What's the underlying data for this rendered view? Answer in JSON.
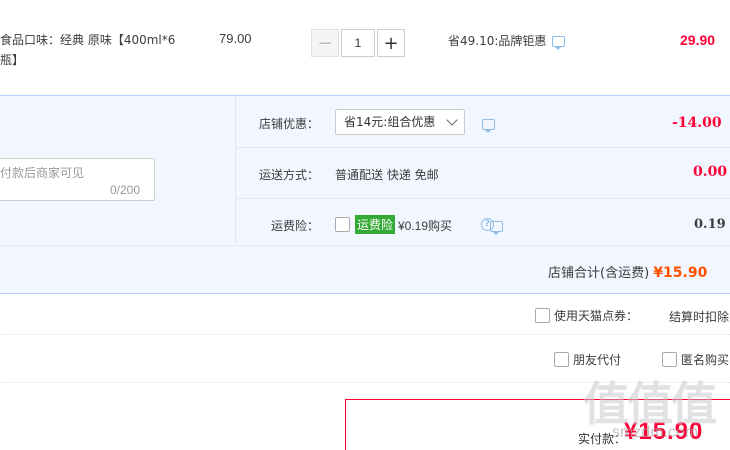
{
  "product": {
    "title_line1": "食品口味：经典 原味【400ml*6",
    "title_line2": "瓶】",
    "unit_price": "79.00",
    "quantity": "1",
    "minus_label": "−",
    "plus_label": "+",
    "promo_text": "省49.10:品牌钜惠",
    "item_total": "29.90"
  },
  "memo": {
    "placeholder": "付款后商家可见",
    "counter": "0/200"
  },
  "store": {
    "discount_label": "店铺优惠：",
    "discount_selected": "省14元:组合优惠",
    "discount_value": "-14.00",
    "shipping_label": "运送方式：",
    "shipping_value_text": "普通配送 快递 免邮",
    "shipping_value": "0.00",
    "insurance_label": "运费险：",
    "insurance_tag": "运费险",
    "insurance_price": "¥0.19购买",
    "insurance_value": "0.19",
    "total_label": "店铺合计(含运费)",
    "total_value": "¥15.90"
  },
  "options": {
    "tmall_points_label": "使用天猫点券：",
    "tmall_points_value": "结算时扣除",
    "friend_pay_label": "朋友代付",
    "anonymous_label": "匿名购买"
  },
  "payment": {
    "label": "实付款：",
    "amount": "¥15.90"
  },
  "watermark": {
    "logo_text": "值值值",
    "site": "smzdm.com"
  },
  "colors": {
    "accent_red": "#ff0036",
    "orange": "#ff5000",
    "store_bg": "#f2f7ff",
    "border_blue": "#b2d1ff",
    "insurance_green": "#33aa33"
  },
  "icons": [
    "message-icon",
    "chevron-down-icon",
    "question-icon",
    "checkbox-icon"
  ]
}
